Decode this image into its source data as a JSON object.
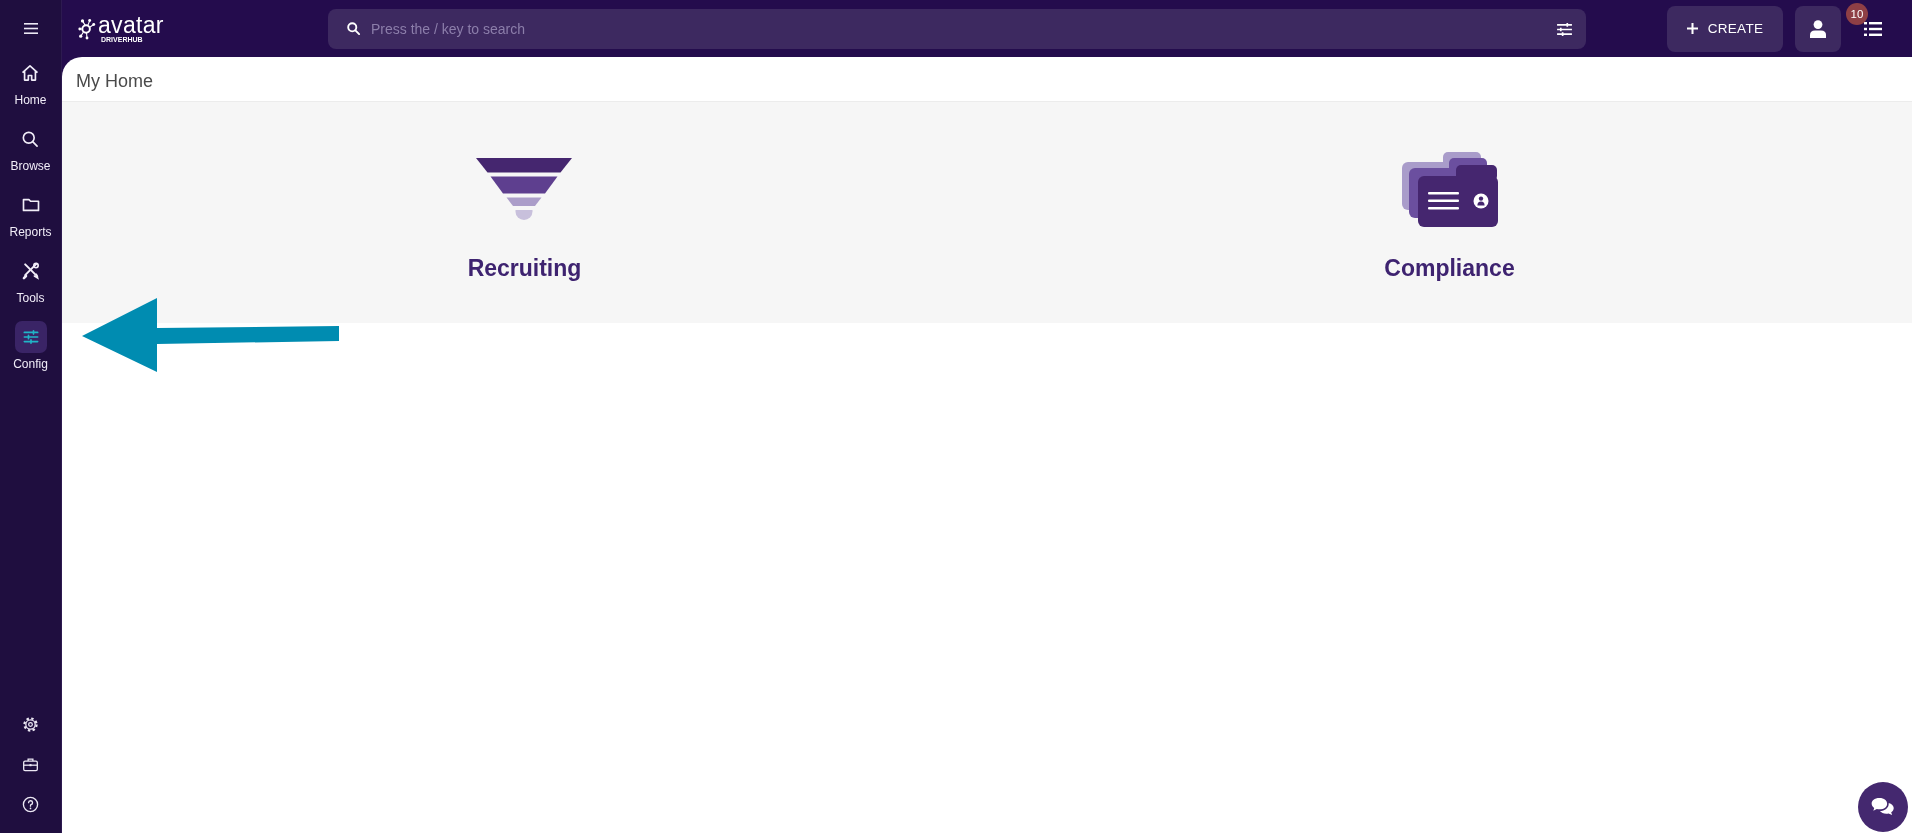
{
  "sidebar": {
    "items": [
      {
        "label": "Home",
        "selected": false
      },
      {
        "label": "Browse",
        "selected": false
      },
      {
        "label": "Reports",
        "selected": false
      },
      {
        "label": "Tools",
        "selected": false
      },
      {
        "label": "Config",
        "selected": true
      }
    ]
  },
  "top_bar": {
    "logo": {
      "wordmark": "avatar",
      "tagline": "DRIVERHUB"
    },
    "search": {
      "placeholder": "Press the / key to search"
    },
    "create_button": {
      "label": "CREATE"
    },
    "notifications": {
      "badge": "10"
    }
  },
  "page": {
    "title": "My Home",
    "tiles": [
      {
        "label": "Recruiting"
      },
      {
        "label": "Compliance"
      }
    ]
  }
}
